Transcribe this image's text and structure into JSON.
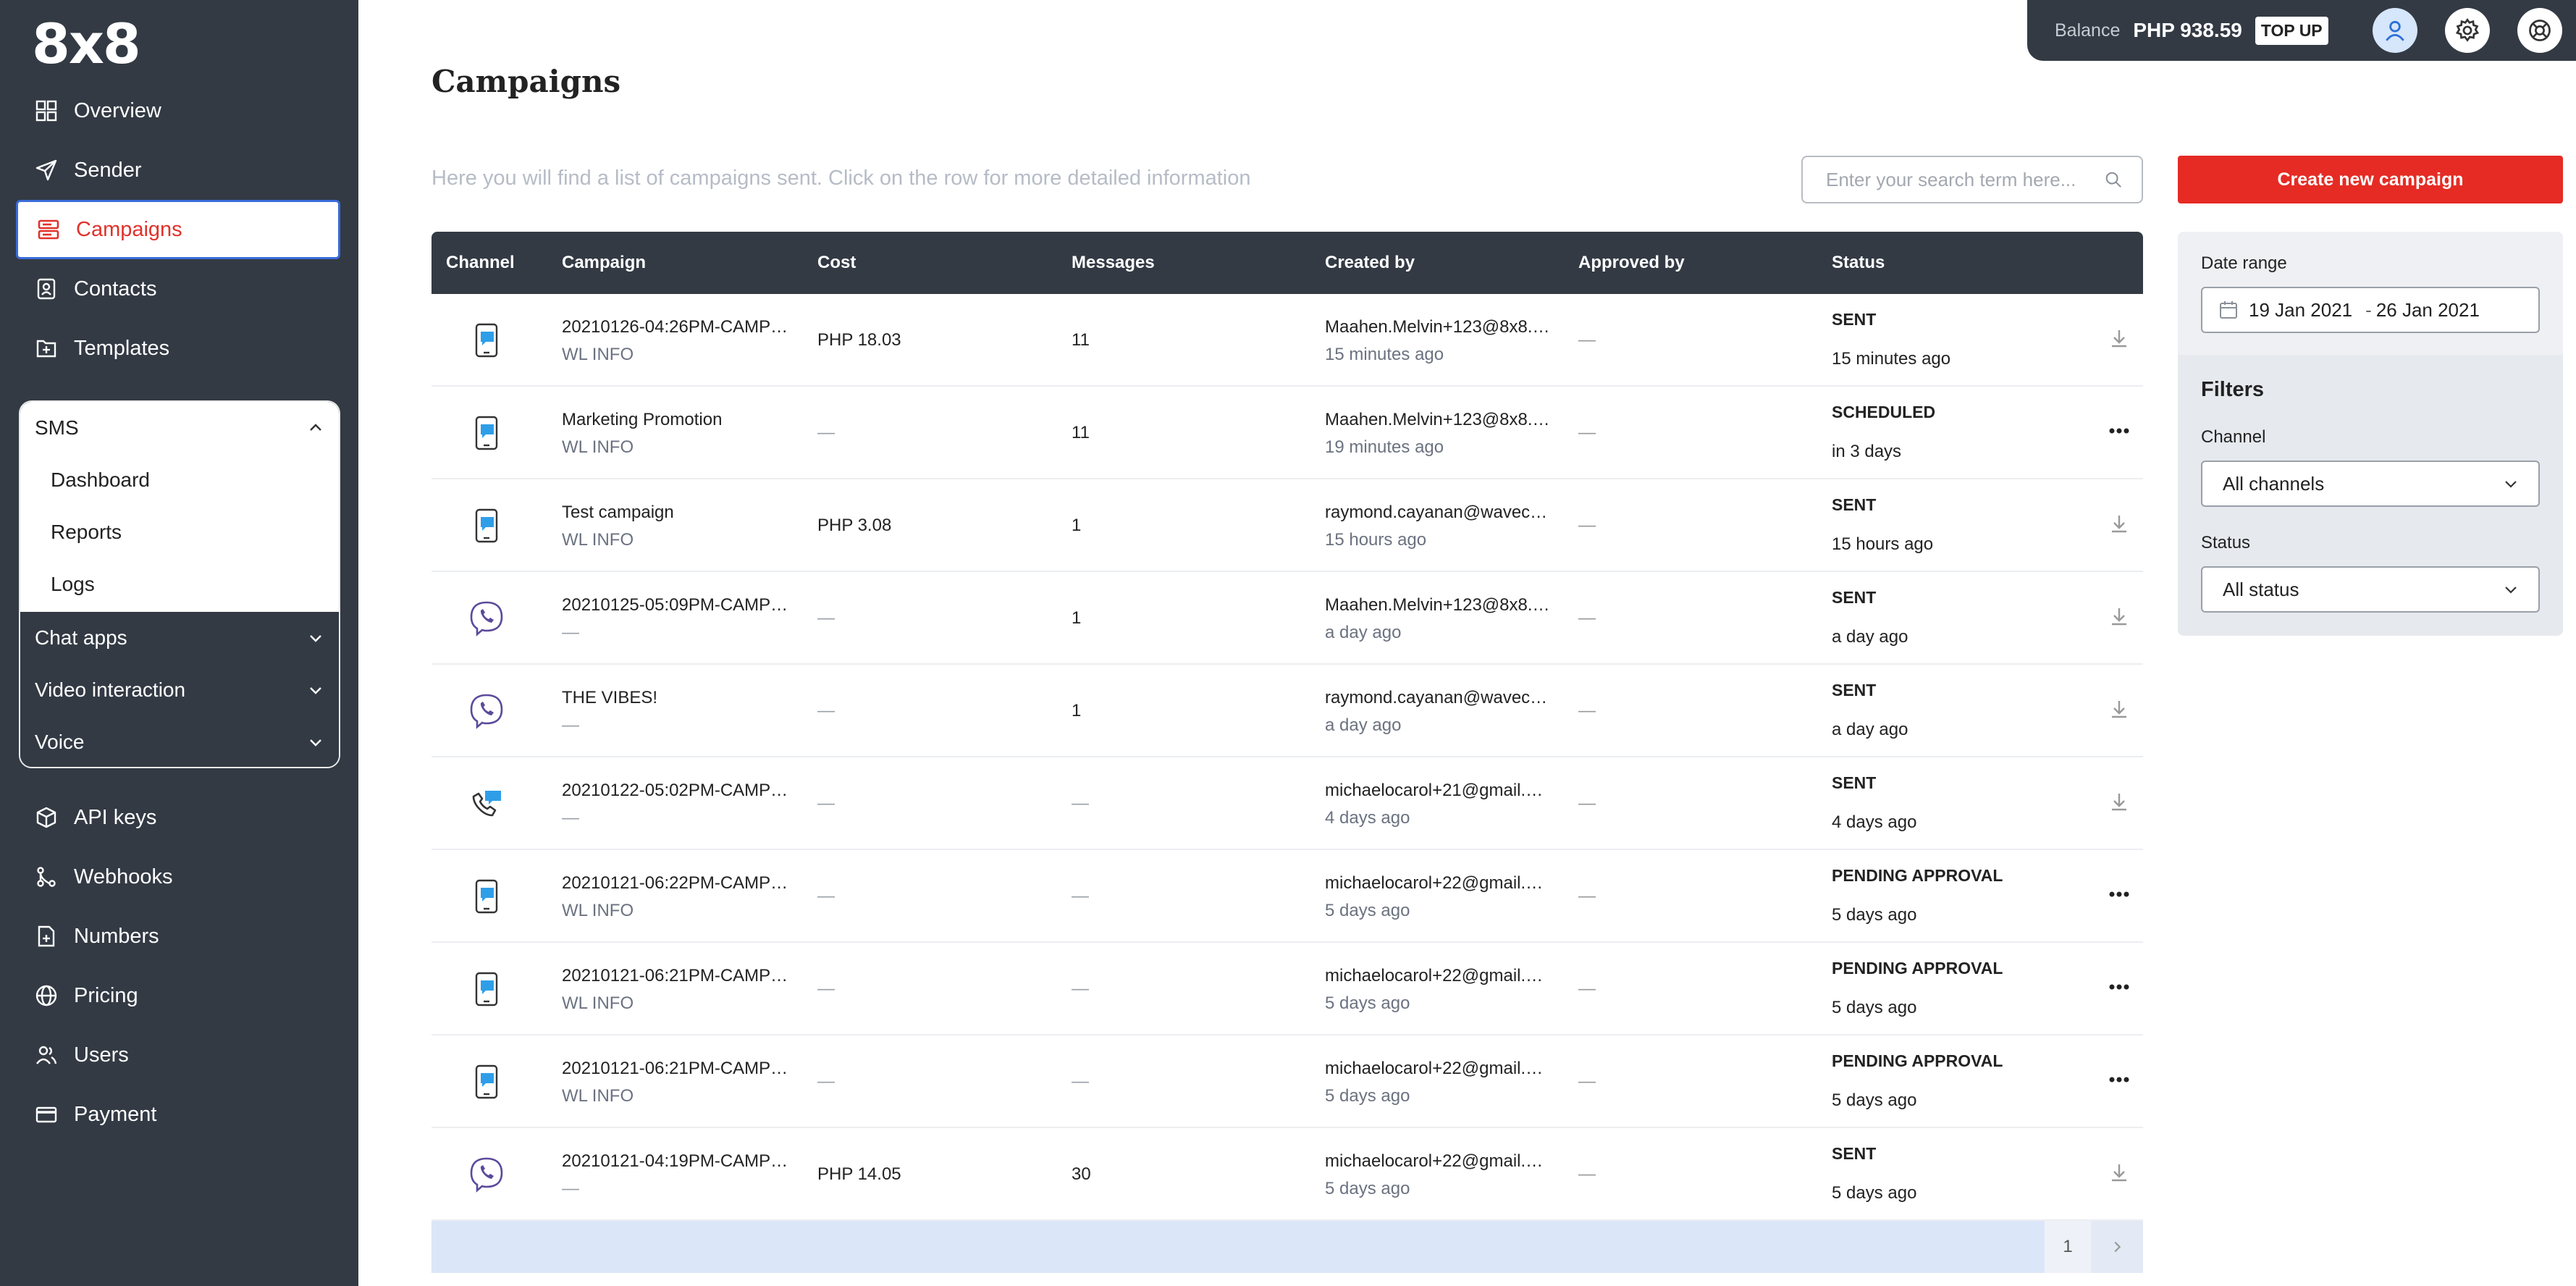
{
  "sidebar": {
    "logo": "8x8",
    "nav_top": [
      {
        "label": "Overview",
        "icon": "grid-icon"
      },
      {
        "label": "Sender",
        "icon": "send-icon"
      },
      {
        "label": "Campaigns",
        "icon": "campaigns-icon",
        "active": true
      },
      {
        "label": "Contacts",
        "icon": "contacts-icon"
      },
      {
        "label": "Templates",
        "icon": "templates-icon"
      }
    ],
    "sms_group": {
      "label": "SMS",
      "sub_items": [
        "Dashboard",
        "Reports",
        "Logs"
      ],
      "collapsed_groups": [
        "Chat apps",
        "Video interaction",
        "Voice"
      ]
    },
    "nav_bottom": [
      {
        "label": "API keys",
        "icon": "key-cube-icon"
      },
      {
        "label": "Webhooks",
        "icon": "webhooks-icon"
      },
      {
        "label": "Numbers",
        "icon": "numbers-icon"
      },
      {
        "label": "Pricing",
        "icon": "globe-icon"
      },
      {
        "label": "Users",
        "icon": "users-icon"
      },
      {
        "label": "Payment",
        "icon": "card-icon"
      }
    ]
  },
  "topbar": {
    "balance_label": "Balance",
    "balance_amount": "PHP 938.59",
    "topup_label": "TOP UP"
  },
  "page": {
    "title": "Campaigns",
    "subtitle": "Here you will find a list of campaigns sent. Click on the row for more detailed information",
    "search_placeholder": "Enter your search term here...",
    "create_button": "Create new campaign"
  },
  "table": {
    "headers": [
      "Channel",
      "Campaign",
      "Cost",
      "Messages",
      "Created by",
      "Approved by",
      "Status"
    ],
    "rows": [
      {
        "channel": "sms",
        "campaign": "20210126-04:26PM-CAMP…",
        "sub": "WL INFO",
        "cost": "PHP 18.03",
        "messages": "11",
        "created_by": "Maahen.Melvin+123@8x8.…",
        "created_ago": "15 minutes ago",
        "approved_by": "—",
        "status": "SENT",
        "status_time": "15 minutes ago",
        "action": "download"
      },
      {
        "channel": "sms",
        "campaign": "Marketing Promotion",
        "sub": "WL INFO",
        "cost": "—",
        "messages": "11",
        "created_by": "Maahen.Melvin+123@8x8.…",
        "created_ago": "19 minutes ago",
        "approved_by": "—",
        "status": "SCHEDULED",
        "status_time": "in 3 days",
        "action": "more"
      },
      {
        "channel": "sms",
        "campaign": "Test campaign",
        "sub": "WL INFO",
        "cost": "PHP 3.08",
        "messages": "1",
        "created_by": "raymond.cayanan@wavec…",
        "created_ago": "15 hours ago",
        "approved_by": "—",
        "status": "SENT",
        "status_time": "15 hours ago",
        "action": "download"
      },
      {
        "channel": "viber",
        "campaign": "20210125-05:09PM-CAMP…",
        "sub": "—",
        "cost": "—",
        "messages": "1",
        "created_by": "Maahen.Melvin+123@8x8.…",
        "created_ago": "a day ago",
        "approved_by": "—",
        "status": "SENT",
        "status_time": "a day ago",
        "action": "download"
      },
      {
        "channel": "viber",
        "campaign": "THE VIBES!",
        "sub": "—",
        "cost": "—",
        "messages": "1",
        "created_by": "raymond.cayanan@wavec…",
        "created_ago": "a day ago",
        "approved_by": "—",
        "status": "SENT",
        "status_time": "a day ago",
        "action": "download"
      },
      {
        "channel": "voice",
        "campaign": "20210122-05:02PM-CAMP…",
        "sub": "—",
        "cost": "—",
        "messages": "—",
        "created_by": "michaelocarol+21@gmail.…",
        "created_ago": "4 days ago",
        "approved_by": "—",
        "status": "SENT",
        "status_time": "4 days ago",
        "action": "download"
      },
      {
        "channel": "sms",
        "campaign": "20210121-06:22PM-CAMP…",
        "sub": "WL INFO",
        "cost": "—",
        "messages": "—",
        "created_by": "michaelocarol+22@gmail.…",
        "created_ago": "5 days ago",
        "approved_by": "—",
        "status": "PENDING APPROVAL",
        "status_time": "5 days ago",
        "action": "more"
      },
      {
        "channel": "sms",
        "campaign": "20210121-06:21PM-CAMP…",
        "sub": "WL INFO",
        "cost": "—",
        "messages": "—",
        "created_by": "michaelocarol+22@gmail.…",
        "created_ago": "5 days ago",
        "approved_by": "—",
        "status": "PENDING APPROVAL",
        "status_time": "5 days ago",
        "action": "more"
      },
      {
        "channel": "sms",
        "campaign": "20210121-06:21PM-CAMP…",
        "sub": "WL INFO",
        "cost": "—",
        "messages": "—",
        "created_by": "michaelocarol+22@gmail.…",
        "created_ago": "5 days ago",
        "approved_by": "—",
        "status": "PENDING APPROVAL",
        "status_time": "5 days ago",
        "action": "more"
      },
      {
        "channel": "viber",
        "campaign": "20210121-04:19PM-CAMP…",
        "sub": "—",
        "cost": "PHP 14.05",
        "messages": "30",
        "created_by": "michaelocarol+22@gmail.…",
        "created_ago": "5 days ago",
        "approved_by": "—",
        "status": "SENT",
        "status_time": "5 days ago",
        "action": "download"
      }
    ],
    "page_number": "1"
  },
  "date_range": {
    "label": "Date range",
    "from": "19 Jan 2021",
    "separator": "-",
    "to": "26 Jan 2021"
  },
  "filters": {
    "title": "Filters",
    "channel_label": "Channel",
    "channel_value": "All channels",
    "status_label": "Status",
    "status_value": "All status"
  },
  "colors": {
    "sidebar_bg": "#333a44",
    "accent_red": "#e52b24",
    "active_border": "#3a6bd8"
  }
}
